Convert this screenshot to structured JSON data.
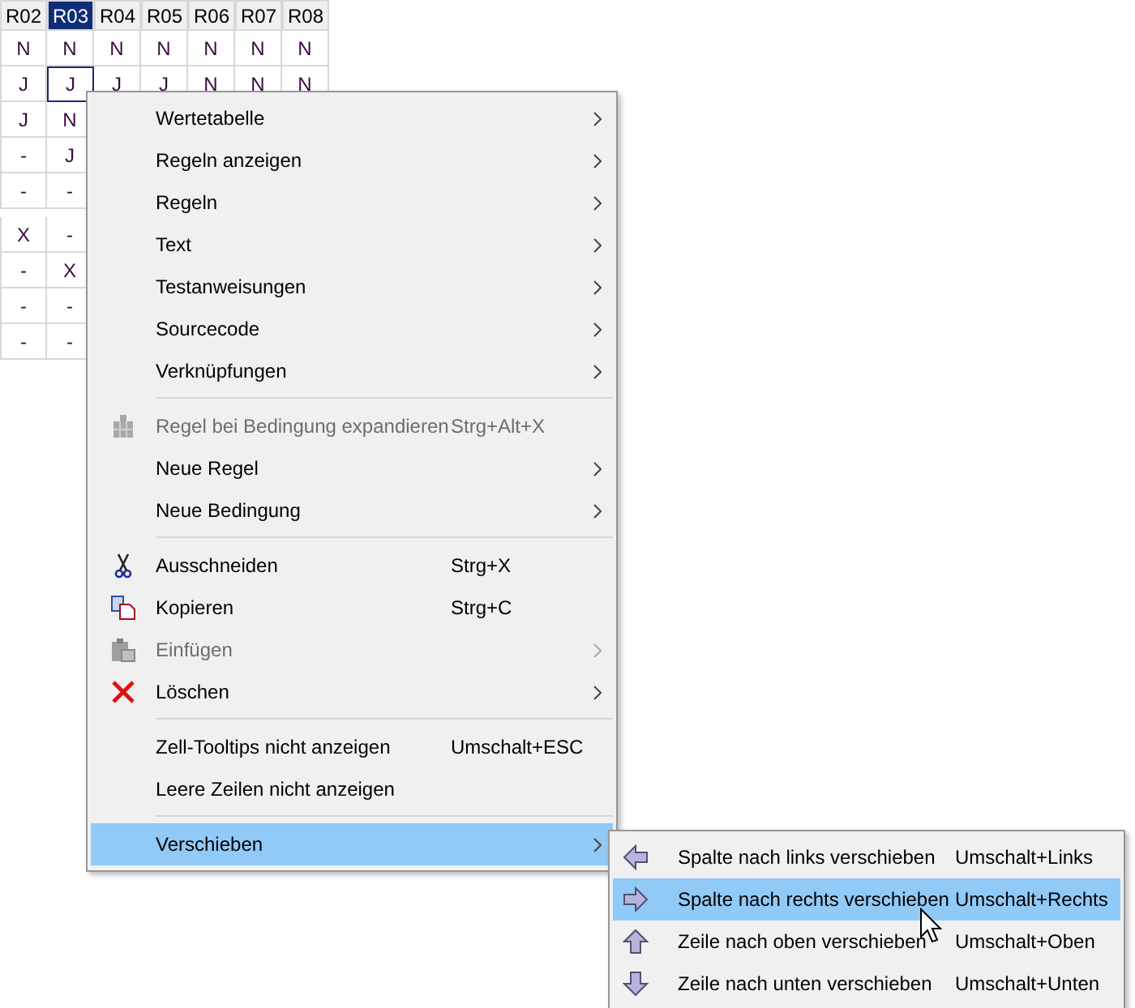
{
  "table": {
    "columns": [
      {
        "label": "R02",
        "selected": false
      },
      {
        "label": "R03",
        "selected": true
      },
      {
        "label": "R04",
        "selected": false
      },
      {
        "label": "R05",
        "selected": false
      },
      {
        "label": "R06",
        "selected": false
      },
      {
        "label": "R07",
        "selected": false
      },
      {
        "label": "R08",
        "selected": false
      }
    ],
    "groups": [
      {
        "rows": [
          [
            {
              "text": "N",
              "selected": false
            },
            {
              "text": "N",
              "selected": false
            },
            {
              "text": "N",
              "selected": false
            },
            {
              "text": "N",
              "selected": false
            },
            {
              "text": "N",
              "selected": false
            },
            {
              "text": "N",
              "selected": false
            },
            {
              "text": "N",
              "selected": false
            }
          ],
          [
            {
              "text": "J",
              "selected": false
            },
            {
              "text": "J",
              "selected": true
            },
            {
              "text": "J",
              "selected": false
            },
            {
              "text": "J",
              "selected": false
            },
            {
              "text": "N",
              "selected": false
            },
            {
              "text": "N",
              "selected": false
            },
            {
              "text": "N",
              "selected": false
            }
          ],
          [
            {
              "text": "J",
              "selected": false
            },
            {
              "text": "N",
              "selected": false
            }
          ],
          [
            {
              "text": "-",
              "selected": false
            },
            {
              "text": "J",
              "selected": false
            }
          ],
          [
            {
              "text": "-",
              "selected": false
            },
            {
              "text": "-",
              "selected": false
            }
          ]
        ]
      },
      {
        "rows": [
          [
            {
              "text": "X",
              "selected": false
            },
            {
              "text": "-",
              "selected": false
            }
          ],
          [
            {
              "text": "-",
              "selected": false
            },
            {
              "text": "X",
              "selected": false
            }
          ],
          [
            {
              "text": "-",
              "selected": false
            },
            {
              "text": "-",
              "selected": false
            }
          ],
          [
            {
              "text": "-",
              "selected": false
            },
            {
              "text": "-",
              "selected": false
            }
          ]
        ]
      }
    ]
  },
  "context_menu": {
    "items": [
      {
        "kind": "item",
        "label": "Wertetabelle",
        "submenu": true,
        "disabled": false,
        "selected": false
      },
      {
        "kind": "item",
        "label": "Regeln anzeigen",
        "submenu": true,
        "disabled": false,
        "selected": false
      },
      {
        "kind": "item",
        "label": "Regeln",
        "submenu": true,
        "disabled": false,
        "selected": false
      },
      {
        "kind": "item",
        "label": "Text",
        "submenu": true,
        "disabled": false,
        "selected": false
      },
      {
        "kind": "item",
        "label": "Testanweisungen",
        "submenu": true,
        "disabled": false,
        "selected": false
      },
      {
        "kind": "item",
        "label": "Sourcecode",
        "submenu": true,
        "disabled": false,
        "selected": false
      },
      {
        "kind": "item",
        "label": "Verknüpfungen",
        "submenu": true,
        "disabled": false,
        "selected": false
      },
      {
        "kind": "separator"
      },
      {
        "kind": "expand",
        "label": "Regel bei Bedingung expandieren",
        "shortcut": "Strg+Alt+X",
        "submenu": false,
        "disabled": true,
        "selected": false
      },
      {
        "kind": "item",
        "label": "Neue Regel",
        "submenu": true,
        "disabled": false,
        "selected": false
      },
      {
        "kind": "item",
        "label": "Neue Bedingung",
        "submenu": true,
        "disabled": false,
        "selected": false
      },
      {
        "kind": "separator"
      },
      {
        "kind": "cut",
        "label": "Ausschneiden",
        "shortcut": "Strg+X",
        "submenu": false,
        "disabled": false,
        "selected": false
      },
      {
        "kind": "copy",
        "label": "Kopieren",
        "shortcut": "Strg+C",
        "submenu": false,
        "disabled": false,
        "selected": false
      },
      {
        "kind": "paste",
        "label": "Einfügen",
        "submenu": true,
        "disabled": true,
        "selected": false
      },
      {
        "kind": "delete",
        "label": "Löschen",
        "submenu": true,
        "disabled": false,
        "selected": false
      },
      {
        "kind": "separator"
      },
      {
        "kind": "item",
        "label": "Zell-Tooltips nicht anzeigen",
        "shortcut": "Umschalt+ESC",
        "submenu": false,
        "disabled": false,
        "selected": false
      },
      {
        "kind": "item",
        "label": "Leere Zeilen nicht anzeigen",
        "submenu": false,
        "disabled": false,
        "selected": false
      },
      {
        "kind": "separator"
      },
      {
        "kind": "item",
        "label": "Verschieben",
        "submenu": true,
        "disabled": false,
        "selected": true
      }
    ]
  },
  "submenu": {
    "items": [
      {
        "kind": "left",
        "label": "Spalte nach links verschieben",
        "shortcut": "Umschalt+Links",
        "selected": false
      },
      {
        "kind": "right",
        "label": "Spalte nach rechts verschieben",
        "shortcut": "Umschalt+Rechts",
        "selected": true
      },
      {
        "kind": "up",
        "label": "Zeile nach oben verschieben",
        "shortcut": "Umschalt+Oben",
        "selected": false
      },
      {
        "kind": "down",
        "label": "Zeile nach unten verschieben",
        "shortcut": "Umschalt+Unten",
        "selected": false
      }
    ]
  }
}
